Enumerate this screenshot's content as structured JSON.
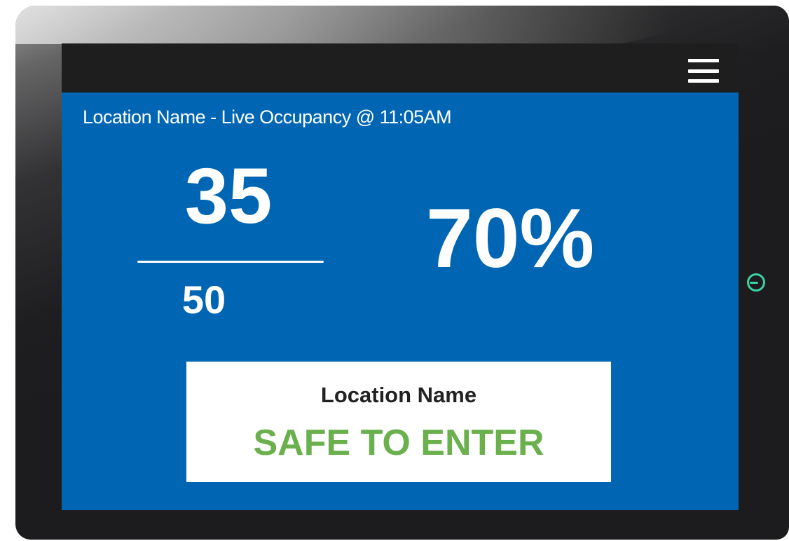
{
  "header": {
    "menu_icon": "hamburger-menu-icon"
  },
  "occupancy": {
    "title": "Location Name - Live Occupancy @ 11:05AM",
    "current": "35",
    "max": "50",
    "percent": "70%"
  },
  "status_card": {
    "location": "Location Name",
    "status": "SAFE TO ENTER",
    "status_color": "#6ab04c"
  },
  "device": {
    "power_icon": "power-icon",
    "power_color": "#3fd1a4"
  },
  "colors": {
    "screen_bg": "#0066b3",
    "top_bar_bg": "#1e1e1f"
  }
}
